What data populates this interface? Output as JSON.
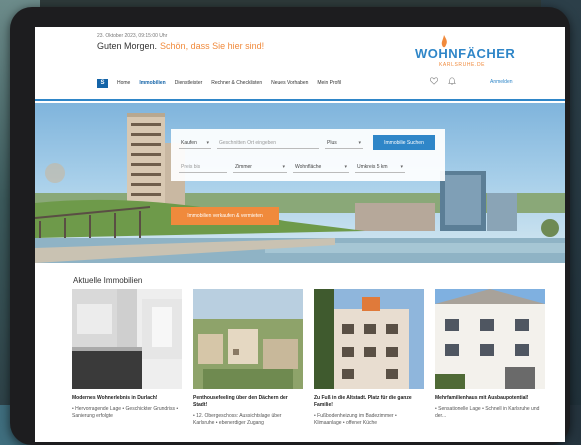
{
  "header": {
    "date": "23. Oktober 2023, 09:15:00 Uhr",
    "greeting": "Guten Morgen.",
    "greeting_highlight": "Schön, dass Sie hier sind!",
    "logo_main": "WOHNFÄCHER",
    "logo_sub": "KARLSRUHE.DE"
  },
  "nav": {
    "logo_text": "S",
    "items": [
      {
        "label": "Home"
      },
      {
        "label": "Immobilien"
      },
      {
        "label": "Dienstleister"
      },
      {
        "label": "Rechner & Checklisten"
      },
      {
        "label": "Neues Vorhaben"
      },
      {
        "label": "Mein Profil"
      }
    ],
    "login": "Anmelden"
  },
  "search": {
    "mode": "Kaufen",
    "location_placeholder": "Geschnitten Ort eingeben",
    "radius": "Plus",
    "button": "Immobilie Suchen",
    "price": "Preis bis",
    "rooms": "Zimmer",
    "area": "Wohnfläche",
    "type": "Umkreis 5 km"
  },
  "cta": "Immobilien verkaufen & vermieten",
  "section_title": "Aktuelle Immobilien",
  "cards": [
    {
      "title": "Modernes Wohnerlebnis in Durlach!",
      "bullet": "• Hervorragende Lage • Geschickter Grundriss • Sanierung erfolgte"
    },
    {
      "title": "Penthousefeeling über den Dächern der Stadt!",
      "bullet": "• 12. Obergeschoss: Aussichtslage über Karlsruhe • ebenerdiger Zugang"
    },
    {
      "title": "Zu Fuß in die Altstadt. Platz für die ganze Familie!",
      "bullet": "• Fußbodenheizung im Badezimmer • Klimaanlage • offener Küche"
    },
    {
      "title": "Mehrfamilienhaus mit Ausbaupotential!",
      "bullet": "• Sensationelle Lage • Schnell in Karlsruhe und der..."
    }
  ],
  "colors": {
    "brand_blue": "#2f86c8",
    "accent_orange": "#f08a3c"
  },
  "icons": {
    "heart": "heart-icon",
    "bell": "bell-icon",
    "chevron": "chevron-down-icon"
  }
}
